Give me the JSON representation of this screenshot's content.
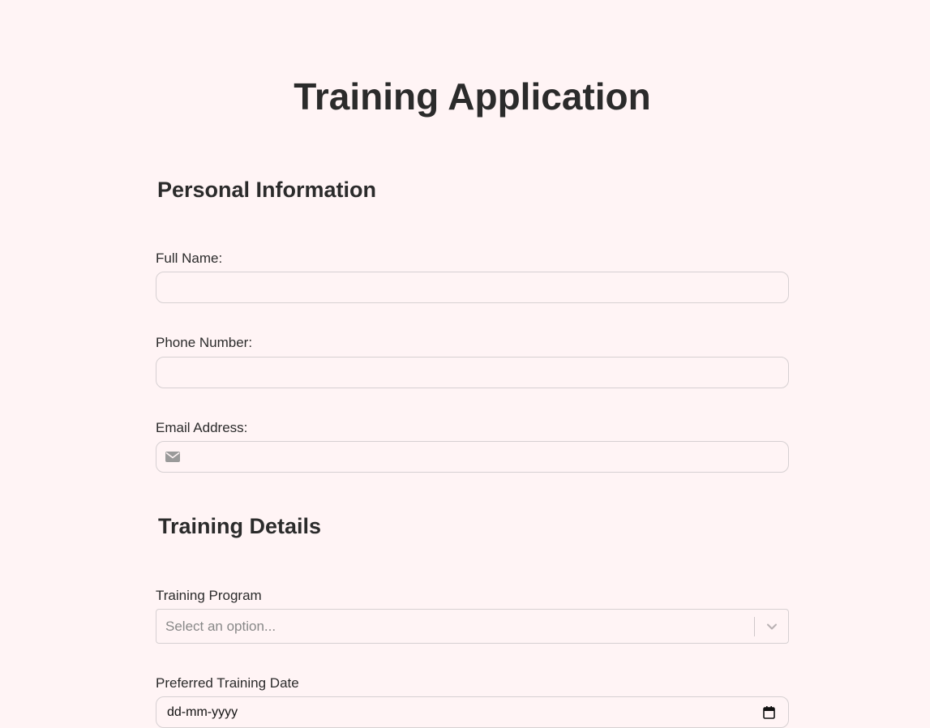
{
  "page": {
    "title": "Training Application"
  },
  "personal_section": {
    "title": "Personal Information",
    "full_name": {
      "label": "Full Name:",
      "value": ""
    },
    "phone": {
      "label": "Phone Number:",
      "value": ""
    },
    "email": {
      "label": "Email Address:",
      "value": "",
      "icon": "envelope-icon"
    }
  },
  "training_section": {
    "title": "Training Details",
    "program": {
      "label": "Training Program",
      "placeholder": "Select an option...",
      "icon": "chevron-down-icon"
    },
    "date": {
      "label": "Preferred Training Date",
      "placeholder": "dd-mm-yyyy",
      "icon": "calendar-icon"
    }
  },
  "colors": {
    "background": "#fff4f5",
    "text": "#2b2b2b",
    "border": "#d6d0d2",
    "placeholder": "#888888"
  }
}
